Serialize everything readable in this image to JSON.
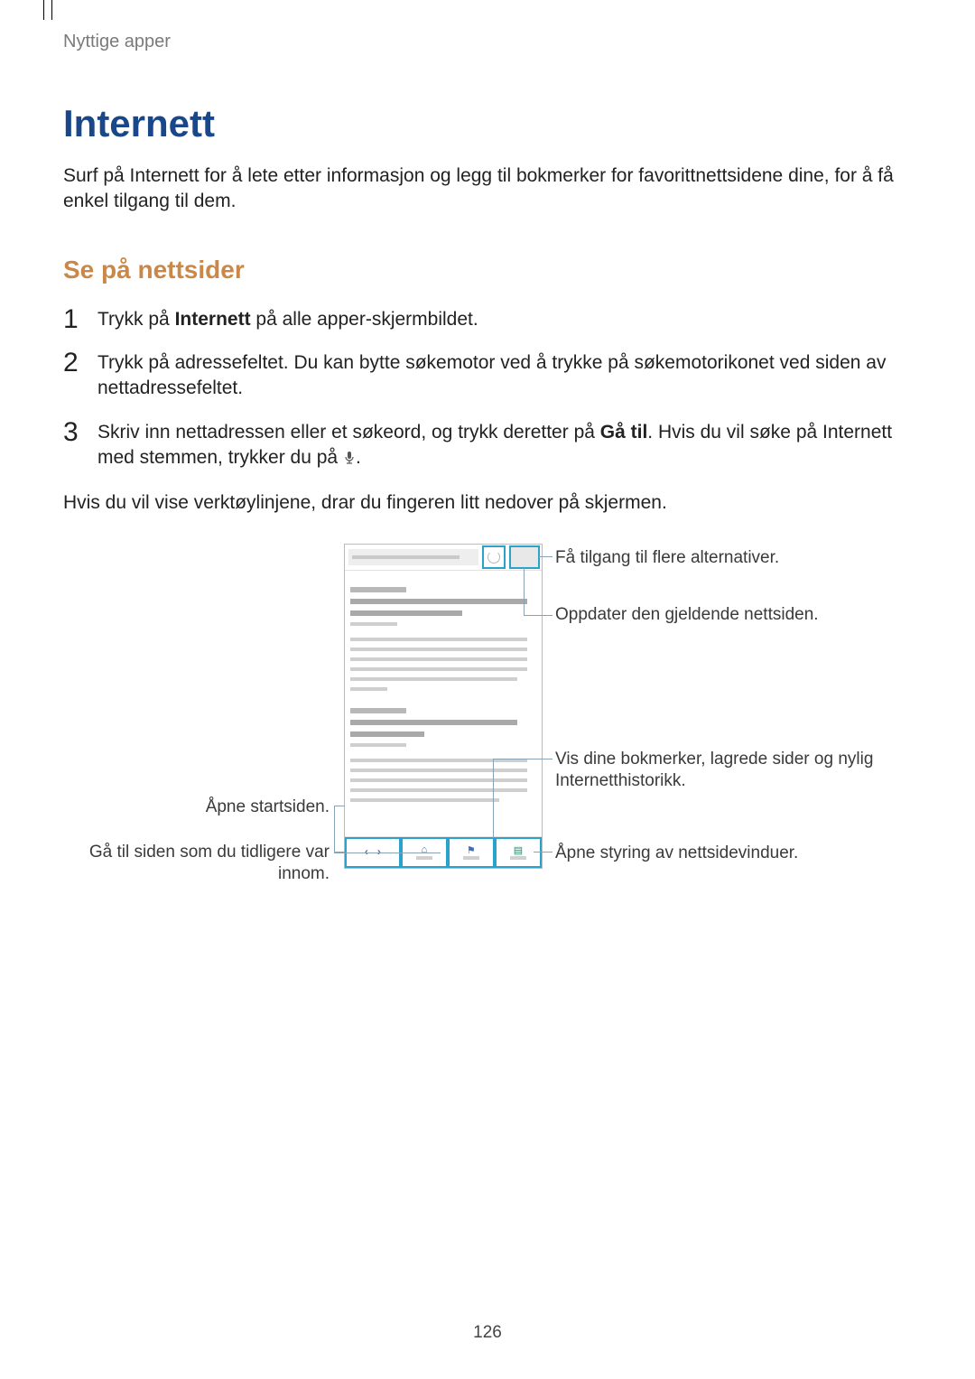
{
  "breadcrumb": "Nyttige apper",
  "title": "Internett",
  "intro": "Surf på Internett for å lete etter informasjon og legg til bokmerker for favorittnettsidene dine, for å få enkel tilgang til dem.",
  "subtitle": "Se på nettsider",
  "steps": [
    {
      "num": "1",
      "pre": "Trykk på ",
      "bold": "Internett",
      "post": " på alle apper-skjermbildet."
    },
    {
      "num": "2",
      "pre": "Trykk på adressefeltet. Du kan bytte søkemotor ved å trykke på søkemotorikonet ved siden av nettadressefeltet.",
      "bold": "",
      "post": ""
    },
    {
      "num": "3",
      "pre": "Skriv inn nettadressen eller et søkeord, og trykk deretter på ",
      "bold": "Gå til",
      "post": ". Hvis du vil søke på Internett med stemmen, trykker du på "
    }
  ],
  "after_steps": "Hvis du vil vise verktøylinjene, drar du fingeren litt nedover på skjermen.",
  "callouts": {
    "more": "Få tilgang til flere alternativer.",
    "refresh": "Oppdater den gjeldende nettsiden.",
    "bookmarks": "Vis dine bokmerker, lagrede sider og nylig Internetthistorikk.",
    "home_left": "Åpne startsiden.",
    "nav_left": "Gå til siden som du tidligere var innom.",
    "tabs": "Åpne styring av nettsidevinduer."
  },
  "page_number": "126"
}
